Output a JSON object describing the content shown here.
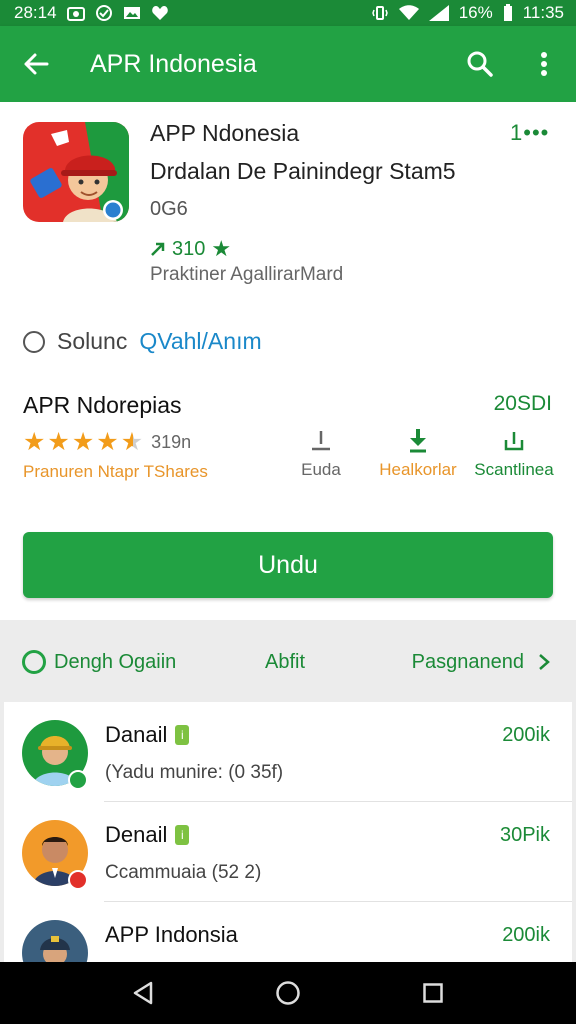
{
  "status_bar": {
    "time": "28:14",
    "right_text": "16%",
    "clock": "11:35"
  },
  "app_bar": {
    "title": "APR Indonesia"
  },
  "detail": {
    "name": "APP Ndonesia",
    "subtitle": "Drdalan De Painindegr Stam5",
    "code": "0G6",
    "rating_value": "310",
    "developer": "Praktiner AgallirarMard",
    "more": "1•••"
  },
  "option": {
    "label": "Solunc",
    "link": "QVahl/Anım"
  },
  "stats": {
    "title": "APR Ndorepias",
    "size": "20SDI",
    "star_rating": 4.5,
    "rating_count": "319n",
    "caption": "Pranuren Ntapr TShares",
    "columns": [
      {
        "label": "Euda",
        "icon": "download-outline-icon"
      },
      {
        "label": "Healkorlar",
        "icon": "download-arrow-icon"
      },
      {
        "label": "Scantlinea",
        "icon": "share-icon"
      }
    ]
  },
  "install": {
    "label": "Undu"
  },
  "filters": {
    "left": "Dengh Ogaiin",
    "middle": "Abfit",
    "right": "Pasgnanend"
  },
  "list": [
    {
      "name": "Danail",
      "sub": "(Yadu munire: (0 35f)",
      "count": "200ik"
    },
    {
      "name": "Denail",
      "sub": "Ccammuaia (52 2)",
      "count": "30Pik"
    },
    {
      "name": "APP Indonsia",
      "sub": "",
      "count": "200ik"
    }
  ],
  "colors": {
    "primary": "#22a244",
    "status": "#1b8a37",
    "accent_orange": "#e8952a",
    "link_blue": "#1a88c9"
  }
}
